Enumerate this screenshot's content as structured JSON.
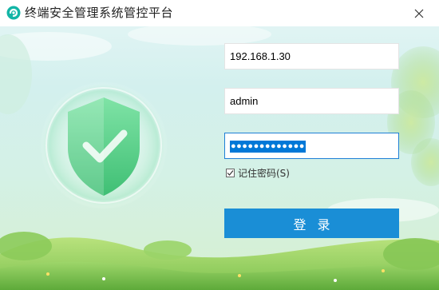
{
  "window": {
    "title": "终端安全管理系统管控平台",
    "app_icon": "app-logo-icon",
    "close_icon": "close-icon"
  },
  "login": {
    "server_value": "192.168.1.30",
    "username_value": "admin",
    "password_mask": "●●●●●●●●●●●●●",
    "remember_label": "记住密码(S)",
    "remember_checked": true,
    "submit_label": "登录"
  },
  "illustration": {
    "emblem": "shield-check-icon"
  },
  "colors": {
    "accent": "#1a8ed6",
    "focus_border": "#1e7fd6",
    "selection": "#0078d7"
  }
}
